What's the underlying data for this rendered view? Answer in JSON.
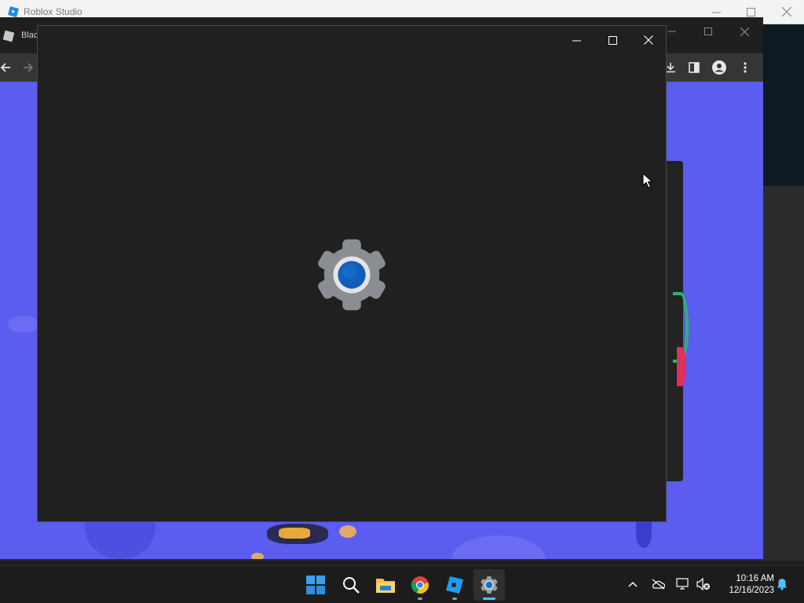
{
  "studio": {
    "title": "Roblox Studio",
    "icons": {
      "logo": "roblox-studio-icon",
      "minimize": "minimize-icon",
      "maximize": "maximize-icon",
      "close": "close-icon"
    }
  },
  "browser": {
    "tab_title": "Blac",
    "icons": {
      "back": "back-arrow-icon",
      "forward": "forward-arrow-icon",
      "download": "download-icon",
      "sidepanel": "side-panel-icon",
      "profile": "profile-icon",
      "menu": "kebab-menu-icon"
    },
    "page_color": "#5b5cf0"
  },
  "settings_window": {
    "state": "loading",
    "icon": "settings-gear-icon",
    "colors": {
      "background": "#202020",
      "gear": "#8a8d91",
      "ring": "#e4e4e4",
      "core": "#0f5fb8"
    }
  },
  "taskbar": {
    "apps": [
      {
        "name": "start",
        "icon": "windows-start-icon"
      },
      {
        "name": "search",
        "icon": "search-icon"
      },
      {
        "name": "file-explorer",
        "icon": "folder-icon"
      },
      {
        "name": "chrome",
        "icon": "chrome-icon"
      },
      {
        "name": "roblox-studio",
        "icon": "roblox-studio-icon"
      },
      {
        "name": "settings",
        "icon": "settings-gear-icon",
        "active": true
      }
    ],
    "tray": {
      "chevron": "chevron-up-icon",
      "onedrive": "cloud-offline-icon",
      "network": "network-icon",
      "volume": "volume-muted-icon",
      "notifications": "bell-icon"
    },
    "time": "10:16 AM",
    "date": "12/16/2023"
  }
}
